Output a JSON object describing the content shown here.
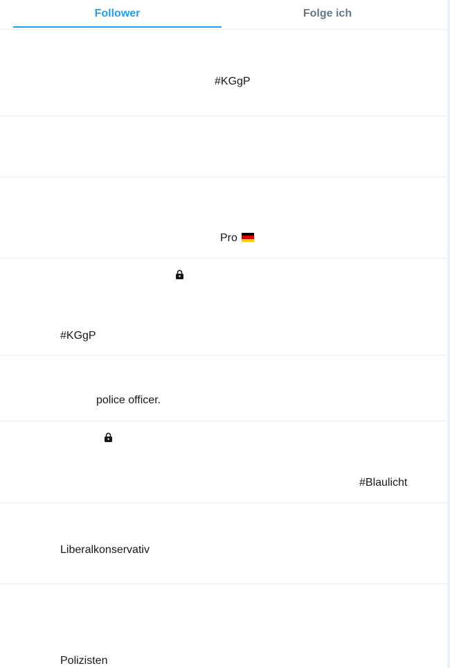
{
  "tabs": [
    {
      "label": "Follower",
      "active": true
    },
    {
      "label": "Folge ich",
      "active": false
    }
  ],
  "rows": [
    {
      "bio": "#KGgP"
    },
    {
      "bio": ""
    },
    {
      "bio": "Pro",
      "flag": "germany-flag"
    },
    {
      "bio": "#KGgP",
      "locked": true
    },
    {
      "bio": "police officer."
    },
    {
      "bio": "#Blaulicht",
      "locked": true
    },
    {
      "bio": "Liberalkonservativ"
    },
    {
      "bio": "Polizisten"
    }
  ],
  "colors": {
    "accent": "#1da1f2",
    "inactive_tab": "#657786",
    "divider": "#e6ecf0"
  }
}
